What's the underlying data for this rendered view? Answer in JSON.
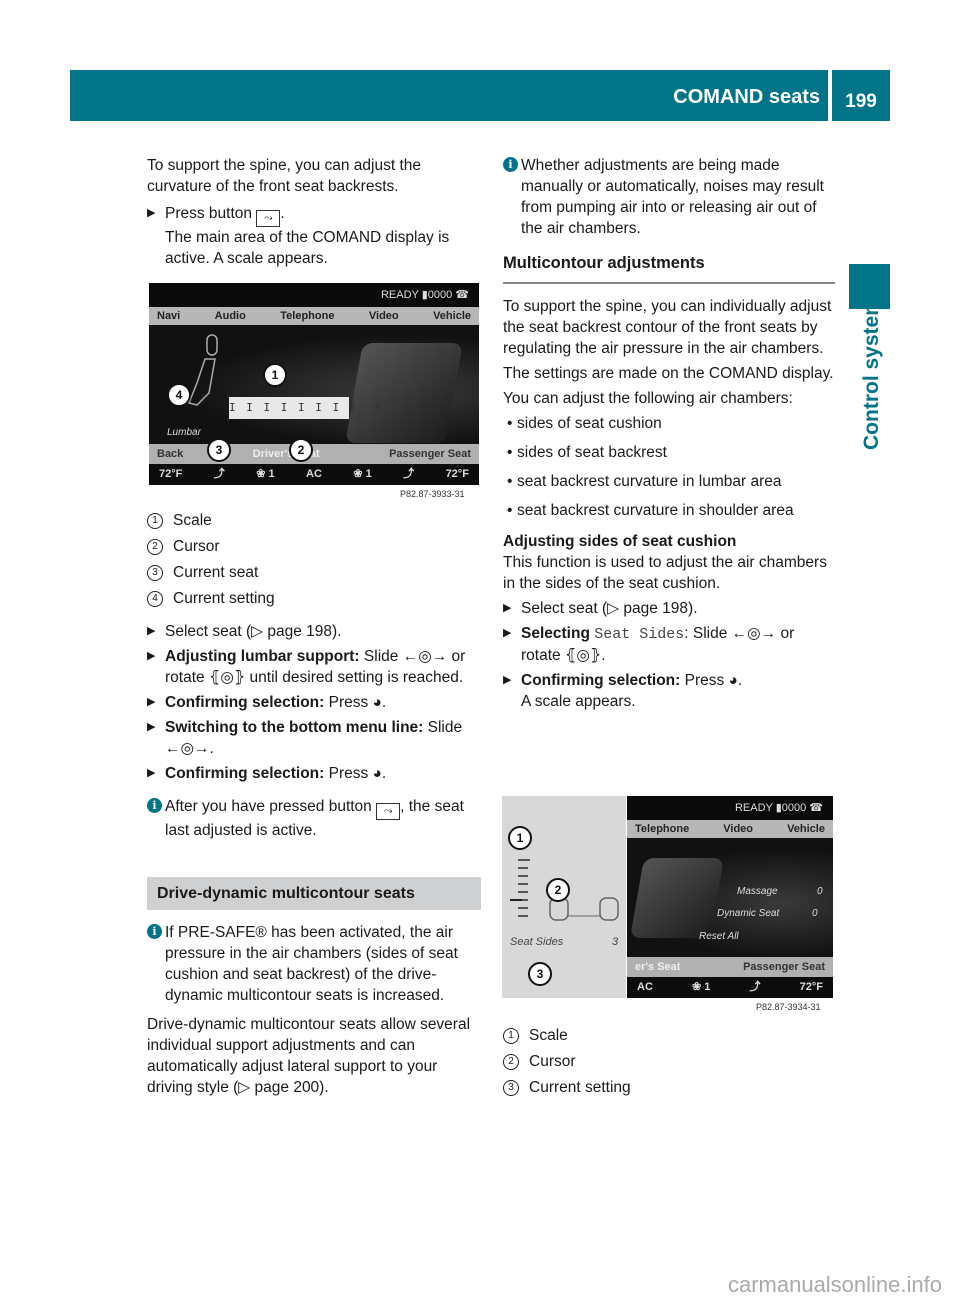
{
  "header": {
    "section_title": "COMAND seats",
    "page_number": "199"
  },
  "side_tab": {
    "label": "Control systems"
  },
  "left": {
    "intro": "To support the spine, you can adjust the curvature of the front seat backrests.",
    "step_press_prefix": "Press button",
    "step_press_suffix": ".",
    "step_press_result": "The main area of the COMAND display is active. A scale appears.",
    "figure1": {
      "status": "READY ▮0000 ☎",
      "menu": [
        "Navi",
        "Audio",
        "Telephone",
        "Video",
        "Vehicle"
      ],
      "setting_label": "Lumbar",
      "scale_text": "I I I I I I I I  R",
      "bottom_menu": [
        "Back",
        "Driver's Seat",
        "Passenger Seat"
      ],
      "climate": [
        "72°F",
        "seat-icon",
        "❀ 1",
        "AC",
        "❀ 1",
        "seat-icon",
        "72°F"
      ],
      "callouts": [
        "1",
        "2",
        "3",
        "4"
      ],
      "ref": "P82.87-3933-31"
    },
    "legend": [
      {
        "num": "1",
        "label": "Scale"
      },
      {
        "num": "2",
        "label": "Cursor"
      },
      {
        "num": "3",
        "label": "Current seat"
      },
      {
        "num": "4",
        "label": "Current setting"
      }
    ],
    "steps": [
      {
        "bold": "",
        "text": "Select seat (▷ page 198)."
      },
      {
        "bold": "Adjusting lumbar support:",
        "text": " Slide ←◎→ or rotate ⦃◎⦄ until desired setting is reached."
      },
      {
        "bold": "Confirming selection:",
        "text": " Press ◕."
      },
      {
        "bold": "Switching to the bottom menu line:",
        "text": " Slide ←◎→."
      },
      {
        "bold": "Confirming selection:",
        "text": " Press ◕."
      }
    ],
    "info_after_prefix": "After you have pressed button",
    "info_after_suffix": ", the seat last adjusted is active.",
    "section_heading": "Drive-dynamic multicontour seats",
    "info_presafe": "If PRE-SAFE® has been activated, the air pressure in the air chambers (sides of seat cushion and seat backrest) of the drive-dynamic multicontour seats is increased.",
    "drive_dynamic_text": "Drive-dynamic multicontour seats allow several individual support adjustments and can automatically adjust lateral support to your driving style (▷ page 200)."
  },
  "right": {
    "info_noise": "Whether adjustments are being made manually or automatically, noises may result from pumping air into or releasing air out of the air chambers.",
    "heading": "Multicontour adjustments",
    "p1": "To support the spine, you can individually adjust the seat backrest contour of the front seats by regulating the air pressure in the air chambers.",
    "p2": "The settings are made on the COMAND display.",
    "p3": "You can adjust the following air chambers:",
    "bullets": [
      "sides of seat cushion",
      "sides of seat backrest",
      "seat backrest curvature in lumbar area",
      "seat backrest curvature in shoulder area"
    ],
    "subheading": "Adjusting sides of seat cushion",
    "sub_p": "This function is used to adjust the air chambers in the sides of the seat cushion.",
    "step1": "Select seat (▷ page 198).",
    "step2_bold": "Selecting",
    "step2_mono": "Seat Sides",
    "step2_text": ": Slide ←◎→ or rotate ⦃◎⦄.",
    "step3_bold": "Confirming selection:",
    "step3_text": " Press ◕.",
    "step3_result": "A scale appears.",
    "figure2": {
      "status": "READY ▮0000 ☎",
      "menu": [
        "Telephone",
        "Video",
        "Vehicle"
      ],
      "options": [
        {
          "label": "Massage",
          "value": "0"
        },
        {
          "label": "Dynamic Seat",
          "value": "0"
        },
        {
          "label": "Reset All",
          "value": ""
        }
      ],
      "setting_label": "Seat Sides",
      "setting_value": "3",
      "bottom_menu": [
        "er's Seat",
        "Passenger Seat"
      ],
      "climate": [
        "AC",
        "❀ 1",
        "seat-icon",
        "72°F"
      ],
      "callouts": [
        "1",
        "2",
        "3"
      ],
      "ref": "P82.87-3934-31"
    },
    "legend": [
      {
        "num": "1",
        "label": "Scale"
      },
      {
        "num": "2",
        "label": "Cursor"
      },
      {
        "num": "3",
        "label": "Current setting"
      }
    ]
  },
  "footer": {
    "watermark": "carmanualsonline.info"
  }
}
